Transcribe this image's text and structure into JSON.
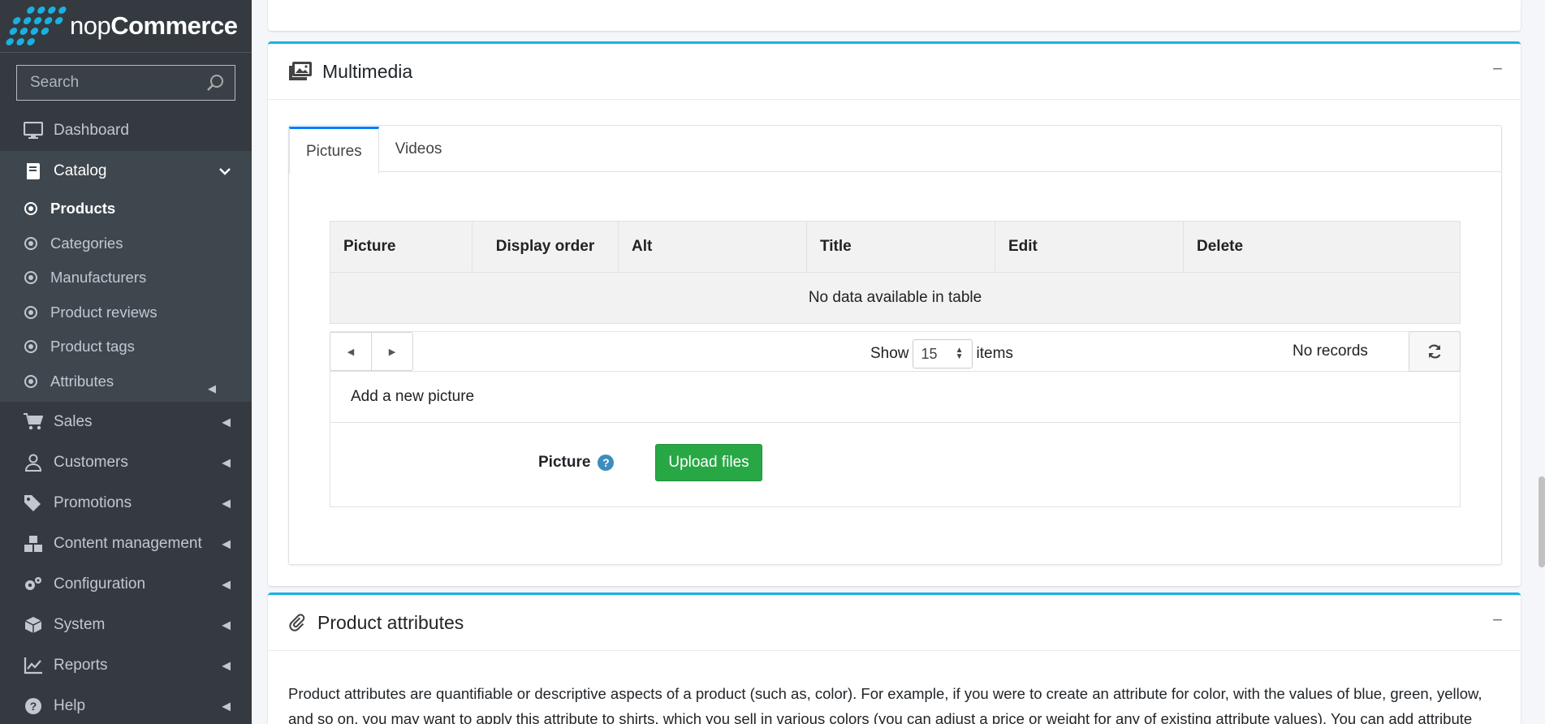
{
  "brand": {
    "prefix": "nop",
    "suffix": "Commerce"
  },
  "search": {
    "placeholder": "Search"
  },
  "sidebar": {
    "items": [
      {
        "label": "Dashboard"
      },
      {
        "label": "Catalog"
      },
      {
        "label": "Sales"
      },
      {
        "label": "Customers"
      },
      {
        "label": "Promotions"
      },
      {
        "label": "Content management"
      },
      {
        "label": "Configuration"
      },
      {
        "label": "System"
      },
      {
        "label": "Reports"
      },
      {
        "label": "Help"
      }
    ],
    "catalog_sub": [
      {
        "label": "Products"
      },
      {
        "label": "Categories"
      },
      {
        "label": "Manufacturers"
      },
      {
        "label": "Product reviews"
      },
      {
        "label": "Product tags"
      },
      {
        "label": "Attributes"
      }
    ]
  },
  "multimedia": {
    "title": "Multimedia",
    "collapse": "−",
    "tabs": [
      {
        "label": "Pictures"
      },
      {
        "label": "Videos"
      }
    ],
    "table": {
      "columns": [
        "Picture",
        "Display order",
        "Alt",
        "Title",
        "Edit",
        "Delete"
      ],
      "empty": "No data available in table"
    },
    "pager": {
      "show": "Show",
      "page_size": "15",
      "items": "items",
      "records": "No records"
    },
    "add_picture": {
      "title": "Add a new picture",
      "picture_label": "Picture",
      "help": "?",
      "upload_label": "Upload files"
    }
  },
  "product_attributes": {
    "title": "Product attributes",
    "collapse": "−",
    "description": "Product attributes are quantifiable or descriptive aspects of a product (such as, color). For example, if you were to create an attribute for color, with the values of blue, green, yellow, and so on, you may want to apply this attribute to shirts, which you sell in various colors (you can adjust a price or weight for any of existing attribute values). You can add attribute"
  },
  "colors": {
    "accent": "#17b2e4",
    "upload": "#28a745",
    "to_top": "#20c997",
    "sidebar": "#343a40"
  }
}
